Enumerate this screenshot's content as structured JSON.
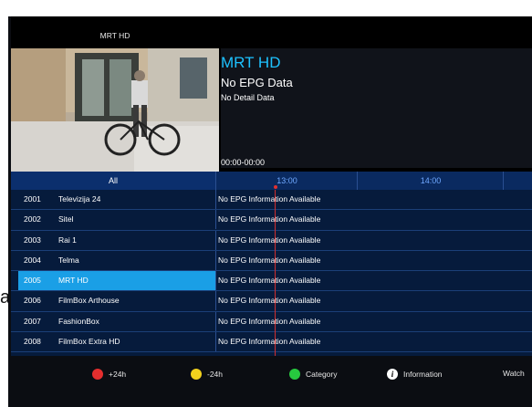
{
  "stray_text": "a",
  "preview": {
    "title": "MRT HD"
  },
  "info": {
    "channel": "MRT HD",
    "status": "No EPG Data",
    "detail": "No Detail Data",
    "time": "00:00-00:00"
  },
  "filter": "All",
  "timeline": [
    "13:00",
    "14:00"
  ],
  "channels": [
    {
      "number": "2001",
      "name": "Televizija 24",
      "program": "No EPG Information Available"
    },
    {
      "number": "2002",
      "name": "Sitel",
      "program": "No EPG Information Available"
    },
    {
      "number": "2003",
      "name": "Rai 1",
      "program": "No EPG Information Available"
    },
    {
      "number": "2004",
      "name": "Telma",
      "program": "No EPG Information Available"
    },
    {
      "number": "2005",
      "name": "MRT HD",
      "program": "No EPG Information Available"
    },
    {
      "number": "2006",
      "name": "FilmBox Arthouse",
      "program": "No EPG Information Available"
    },
    {
      "number": "2007",
      "name": "FashionBox",
      "program": "No EPG Information Available"
    },
    {
      "number": "2008",
      "name": "FilmBox Extra HD",
      "program": "No EPG Information Available"
    }
  ],
  "selected_channel": "2005",
  "footer": {
    "red": {
      "label": "+24h",
      "icon": "red-circle-icon",
      "color": "#e52e2e"
    },
    "yellow": {
      "label": "-24h",
      "icon": "yellow-circle-icon",
      "color": "#f2d11d"
    },
    "green": {
      "label": "Category",
      "icon": "green-circle-icon",
      "color": "#27c93f"
    },
    "info": {
      "label": "Information",
      "icon": "info-icon"
    },
    "watch": {
      "label": "Watch"
    }
  },
  "colors": {
    "accent": "#1dc2ff",
    "selected_row": "#1a9fe6",
    "grid_bg": "#061b3c"
  }
}
